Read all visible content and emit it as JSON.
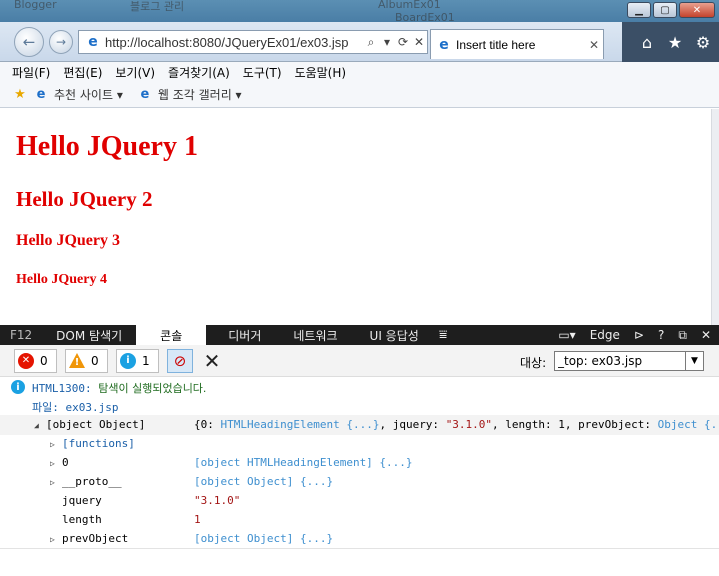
{
  "window": {
    "background_tabs": [
      "Blogger",
      "블로그 관리",
      "AlbumEx01",
      "BoardEx01"
    ],
    "controls": {
      "minimize": "▁",
      "maximize": "▢",
      "close": "✕"
    }
  },
  "navbar": {
    "back_icon": "←",
    "forward_icon": "→",
    "url": "http://localhost:8080/JQueryEx01/ex03.jsp",
    "search_icon": "⌕",
    "refresh_icon": "⟳",
    "stop_icon": "✕",
    "tab_title": "Insert title here",
    "tab_close": "✕",
    "home_icon": "⌂",
    "favorites_icon": "★",
    "tools_icon": "⚙"
  },
  "menubar": {
    "items": [
      "파일(F)",
      "편집(E)",
      "보기(V)",
      "즐겨찾기(A)",
      "도구(T)",
      "도움말(H)"
    ]
  },
  "favorites_bar": {
    "items": [
      {
        "label": "추천 사이트 ▾",
        "icon": "ie-page-icon"
      },
      {
        "label": "웹 조각 갤러리 ▾",
        "icon": "ie-page-icon"
      }
    ]
  },
  "page": {
    "headings": [
      "Hello JQuery 1",
      "Hello JQuery 2",
      "Hello JQuery 3",
      "Hello JQuery 4"
    ],
    "heading_color": "#e00000"
  },
  "devtools": {
    "tabs": [
      "F12",
      "DOM 탐색기",
      "콘솔",
      "디버거",
      "네트워크",
      "UI 응답성"
    ],
    "active_tab": "콘솔",
    "overflow_icon": "⩸",
    "emulation_label": "Edge",
    "right_icons": {
      "emulation": "🖳",
      "console_toggle": "⊳",
      "help": "?",
      "undock": "⧉",
      "close": "✕"
    },
    "counters": {
      "errors": "0",
      "warnings": "0",
      "messages": "1"
    },
    "target_label": "대상:",
    "target_value": "_top: ex03.jsp"
  },
  "console": {
    "info_code": "HTML1300:",
    "info_message": "탐색이 실행되었습니다.",
    "file_line": "파일: ex03.jsp",
    "object_label": "[object Object]",
    "object_summary_prefix": "{0: ",
    "object_summary_v0": "HTMLHeadingElement {...}",
    "object_summary_mid": ", jquery: ",
    "object_summary_jquery": "\"3.1.0\"",
    "object_summary_mid2": ", length: ",
    "object_summary_length": "1",
    "object_summary_mid3": ", prevObject: ",
    "object_summary_prev": "Object {...}",
    "rows": [
      {
        "key": "[functions]",
        "value": "",
        "expandable": true
      },
      {
        "key": "0",
        "value": "[object HTMLHeadingElement] {...}",
        "expandable": true
      },
      {
        "key": "__proto__",
        "value": "[object Object] {...}",
        "expandable": true
      },
      {
        "key": "jquery",
        "value": "\"3.1.0\"",
        "expandable": false
      },
      {
        "key": "length",
        "value": "1",
        "expandable": false
      },
      {
        "key": "prevObject",
        "value": "[object Object] {...}",
        "expandable": true
      }
    ]
  }
}
